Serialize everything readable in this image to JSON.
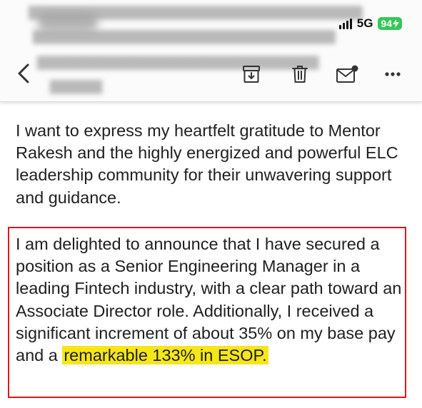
{
  "status_bar": {
    "network": "5G",
    "battery": "94"
  },
  "toolbar": {
    "back_icon": "chevron-left-icon",
    "archive_icon": "archive-icon",
    "delete_icon": "trash-icon",
    "unread_icon": "mail-unread-icon",
    "more_icon": "more-horizontal-icon"
  },
  "email": {
    "paragraph1": "I want to express my heartfelt gratitude to Mentor Rakesh and the highly energized and powerful ELC leadership community for their unwavering support and guidance.",
    "paragraph2_plain": "I am delighted to announce that I have secured a position as a Senior Engineering Manager in a leading Fintech industry, with a clear path toward an Associate Director role. Additionally, I received a significant increment of about 35% on my base pay and a ",
    "paragraph2_highlight": "remarkable 133% in ESOP."
  },
  "colors": {
    "highlight": "#f5e61a",
    "box_border": "#e0161b",
    "battery": "#35c759"
  }
}
